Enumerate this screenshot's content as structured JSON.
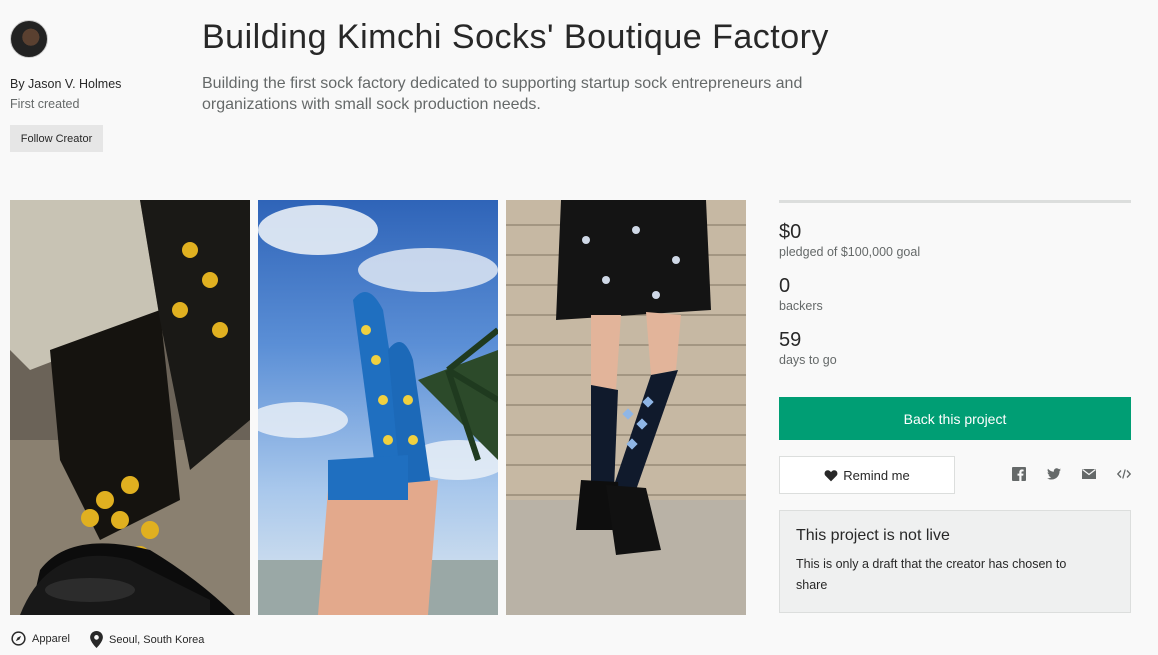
{
  "creator": {
    "name": "By Jason V. Holmes",
    "first_created": "First created",
    "follow_label": "Follow Creator"
  },
  "project": {
    "title": "Building Kimchi Socks' Boutique Factory",
    "blurb": "Building the first sock factory dedicated to supporting startup sock entrepreneurs and organizations with small sock production needs."
  },
  "stats": {
    "pledged": "$0",
    "pledged_label": "pledged of $100,000 goal",
    "backers": "0",
    "backers_label": "backers",
    "days": "59",
    "days_label": "days to go",
    "funding_progress_fraction": 0
  },
  "actions": {
    "back_label": "Back this project",
    "remind_label": "Remind me",
    "share": [
      "facebook-icon",
      "twitter-icon",
      "email-icon",
      "embed-icon"
    ]
  },
  "notice": {
    "title": "This project is not live",
    "body": "This is only a draft that the creator has chosen to share"
  },
  "meta": {
    "category": "Apparel",
    "location": "Seoul, South Korea"
  },
  "colors": {
    "accent": "#009e74",
    "text": "#282828",
    "muted": "#656969"
  }
}
